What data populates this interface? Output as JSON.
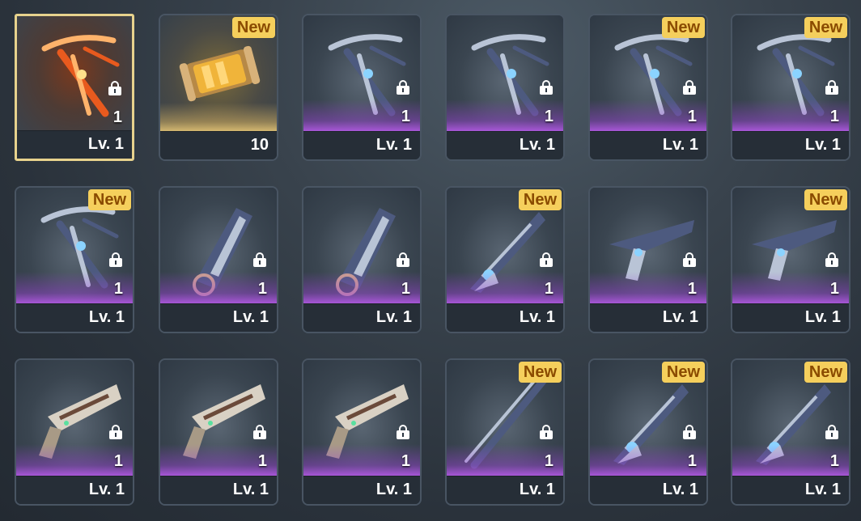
{
  "colors": {
    "selected_border": "#e7d28d",
    "rarity_purple": "#c15ef4",
    "rarity_gold": "#f0cf7c",
    "badge_bg": "#f5cf5c",
    "badge_text": "#8a4b00"
  },
  "badge_label": "New",
  "items": [
    {
      "name": "flame-bow",
      "icon": "bow-icon",
      "rarity": "red",
      "level": "Lv. 1",
      "qty": "1",
      "locked": true,
      "is_new": false,
      "selected": true
    },
    {
      "name": "energy-capsule",
      "icon": "capsule-icon",
      "rarity": "gold",
      "level": "10",
      "qty": "",
      "locked": false,
      "is_new": true,
      "selected": false
    },
    {
      "name": "blue-bow",
      "icon": "bow-icon",
      "rarity": "purple",
      "level": "Lv. 1",
      "qty": "1",
      "locked": true,
      "is_new": false,
      "selected": false
    },
    {
      "name": "dark-bow",
      "icon": "bow-icon",
      "rarity": "purple",
      "level": "Lv. 1",
      "qty": "1",
      "locked": true,
      "is_new": false,
      "selected": false
    },
    {
      "name": "dark-bow-2",
      "icon": "bow-icon",
      "rarity": "purple",
      "level": "Lv. 1",
      "qty": "1",
      "locked": true,
      "is_new": true,
      "selected": false
    },
    {
      "name": "white-bow",
      "icon": "bow-icon",
      "rarity": "purple",
      "level": "Lv. 1",
      "qty": "1",
      "locked": true,
      "is_new": true,
      "selected": false
    },
    {
      "name": "white-bow-2",
      "icon": "bow-icon",
      "rarity": "purple",
      "level": "Lv. 1",
      "qty": "1",
      "locked": true,
      "is_new": true,
      "selected": false
    },
    {
      "name": "blue-gauntlet",
      "icon": "gauntlet-icon",
      "rarity": "purple",
      "level": "Lv. 1",
      "qty": "1",
      "locked": true,
      "is_new": false,
      "selected": false
    },
    {
      "name": "blue-gauntlet-2",
      "icon": "gauntlet-icon",
      "rarity": "purple",
      "level": "Lv. 1",
      "qty": "1",
      "locked": true,
      "is_new": false,
      "selected": false
    },
    {
      "name": "twin-blades",
      "icon": "blade-icon",
      "rarity": "purple",
      "level": "Lv. 1",
      "qty": "1",
      "locked": true,
      "is_new": true,
      "selected": false
    },
    {
      "name": "white-pistol",
      "icon": "pistol-icon",
      "rarity": "purple",
      "level": "Lv. 1",
      "qty": "1",
      "locked": true,
      "is_new": false,
      "selected": false
    },
    {
      "name": "blue-pistol",
      "icon": "pistol-icon",
      "rarity": "purple",
      "level": "Lv. 1",
      "qty": "1",
      "locked": true,
      "is_new": true,
      "selected": false
    },
    {
      "name": "revolver",
      "icon": "revolver-icon",
      "rarity": "purple",
      "level": "Lv. 1",
      "qty": "1",
      "locked": true,
      "is_new": false,
      "selected": false
    },
    {
      "name": "revolver-2",
      "icon": "revolver-icon",
      "rarity": "purple",
      "level": "Lv. 1",
      "qty": "1",
      "locked": true,
      "is_new": false,
      "selected": false
    },
    {
      "name": "revolver-3",
      "icon": "revolver-icon",
      "rarity": "purple",
      "level": "Lv. 1",
      "qty": "1",
      "locked": true,
      "is_new": false,
      "selected": false
    },
    {
      "name": "dark-spear",
      "icon": "spear-icon",
      "rarity": "purple",
      "level": "Lv. 1",
      "qty": "1",
      "locked": true,
      "is_new": true,
      "selected": false
    },
    {
      "name": "toothed-blade",
      "icon": "blade-icon",
      "rarity": "purple",
      "level": "Lv. 1",
      "qty": "1",
      "locked": true,
      "is_new": true,
      "selected": false
    },
    {
      "name": "toothed-blade-2",
      "icon": "blade-icon",
      "rarity": "purple",
      "level": "Lv. 1",
      "qty": "1",
      "locked": true,
      "is_new": true,
      "selected": false
    }
  ]
}
